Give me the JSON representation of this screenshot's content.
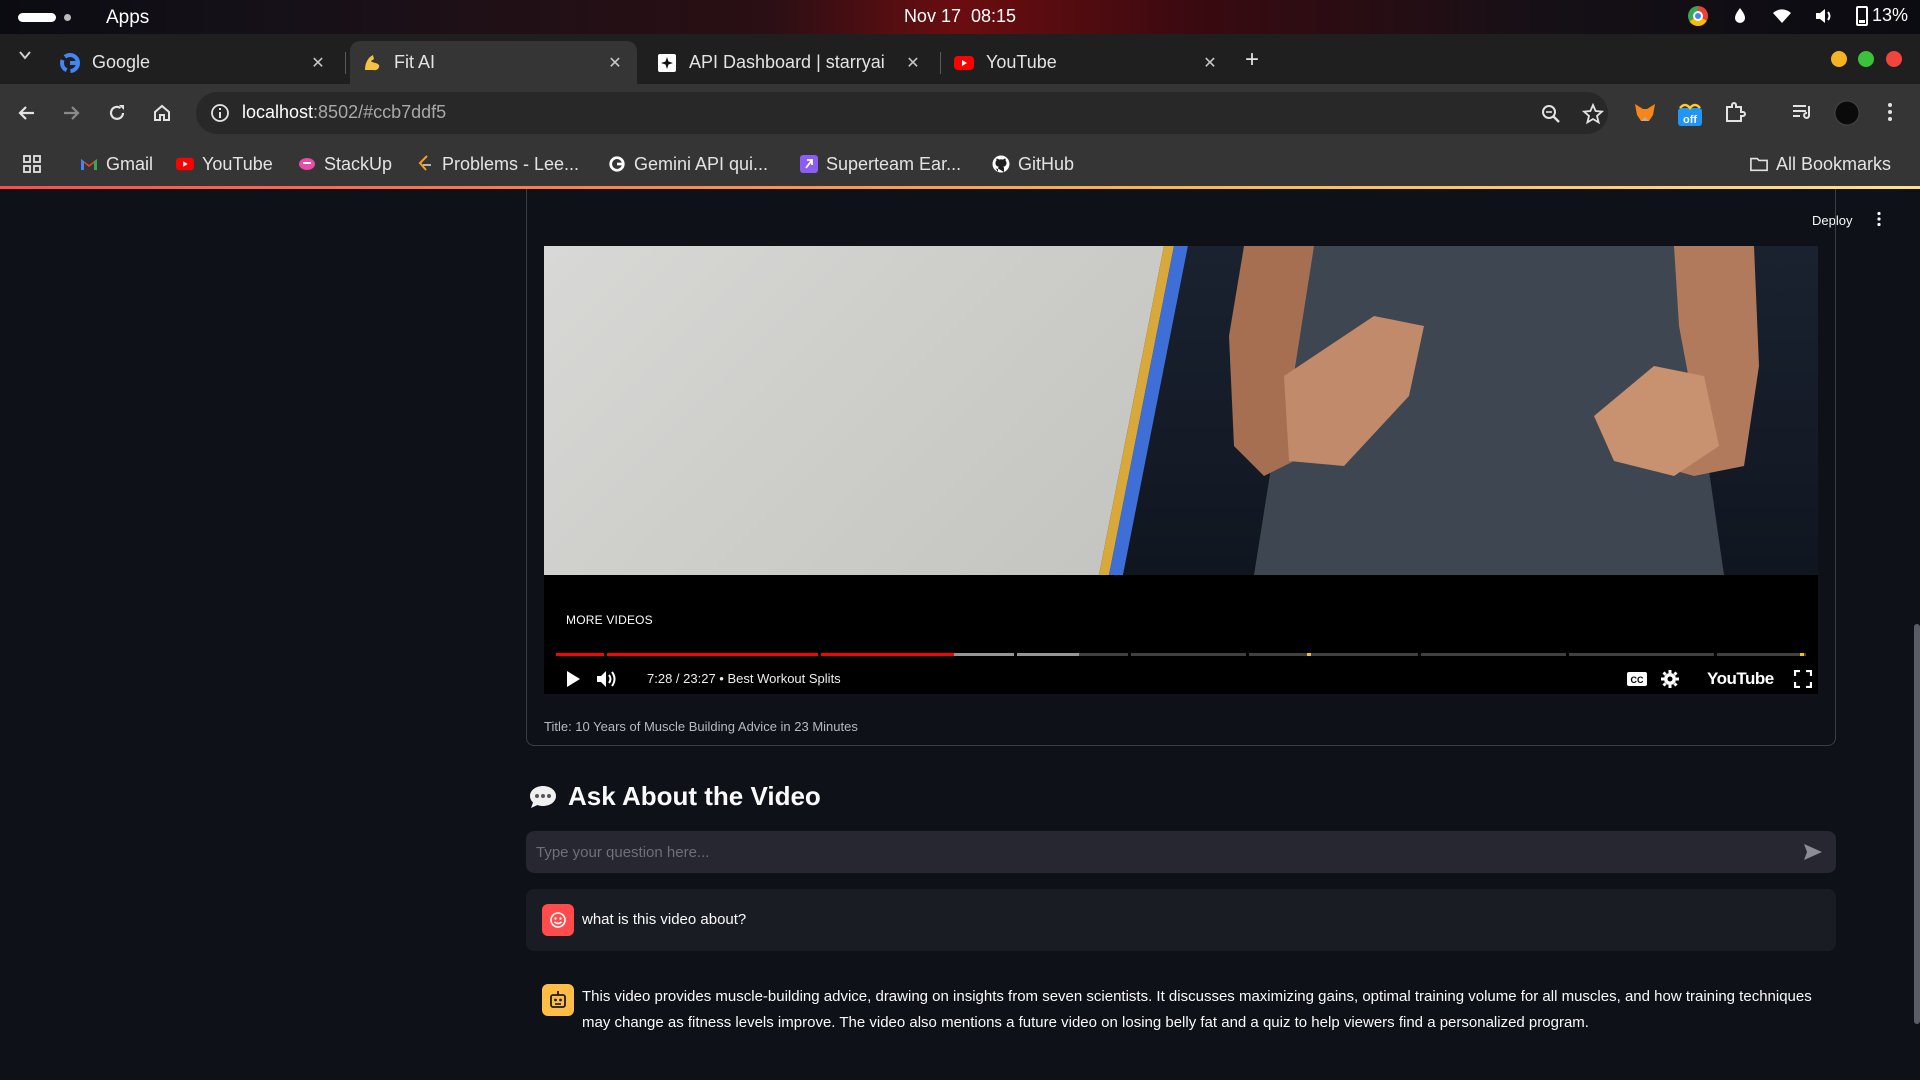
{
  "os": {
    "apps_label": "Apps",
    "date": "Nov 17",
    "time": "08:15",
    "battery": "13%"
  },
  "browser": {
    "tabs": [
      {
        "label": "Google",
        "icon": "google-icon",
        "active": false
      },
      {
        "label": "Fit AI",
        "icon": "flexed-biceps-icon",
        "active": true
      },
      {
        "label": "API Dashboard | starryai",
        "icon": "starryai-icon",
        "active": false
      },
      {
        "label": "YouTube",
        "icon": "youtube-icon",
        "active": false
      }
    ],
    "url_host": "localhost",
    "url_path": ":8502/#ccb7ddf5",
    "bookmarks": [
      {
        "label": "Gmail",
        "icon": "gmail-icon"
      },
      {
        "label": "YouTube",
        "icon": "youtube-icon"
      },
      {
        "label": "StackUp",
        "icon": "stackup-icon"
      },
      {
        "label": "Problems - Lee...",
        "icon": "leetcode-icon"
      },
      {
        "label": "Gemini API qui...",
        "icon": "google-icon"
      },
      {
        "label": "Superteam Ear...",
        "icon": "superteam-icon"
      },
      {
        "label": "GitHub",
        "icon": "github-icon"
      }
    ],
    "all_bookmarks": "All Bookmarks"
  },
  "app": {
    "deploy_label": "Deploy",
    "video": {
      "more_videos": "MORE VIDEOS",
      "time": "7:28 / 23:27",
      "separator": "•",
      "chapter": "Best Workout Splits",
      "progress_fraction": 0.3187,
      "buffer_fraction": 0.3
    },
    "video_caption": "Title: 10 Years of Muscle Building Advice in 23 Minutes",
    "ask_title": "Ask About the Video",
    "chat_placeholder": "Type your question here...",
    "messages": [
      {
        "role": "user",
        "text": "what is this video about?"
      },
      {
        "role": "assistant",
        "text": "This video provides muscle-building advice, drawing on insights from seven scientists. It discusses maximizing gains, optimal training volume for all muscles, and how training techniques may change as fitness levels improve. The video also mentions a future video on losing belly fat and a quiz to help viewers find a personalized program."
      }
    ]
  },
  "colors": {
    "accent_red": "#ff4b4b",
    "bot_yellow": "#ffbd45",
    "app_bg": "#0e1117"
  }
}
